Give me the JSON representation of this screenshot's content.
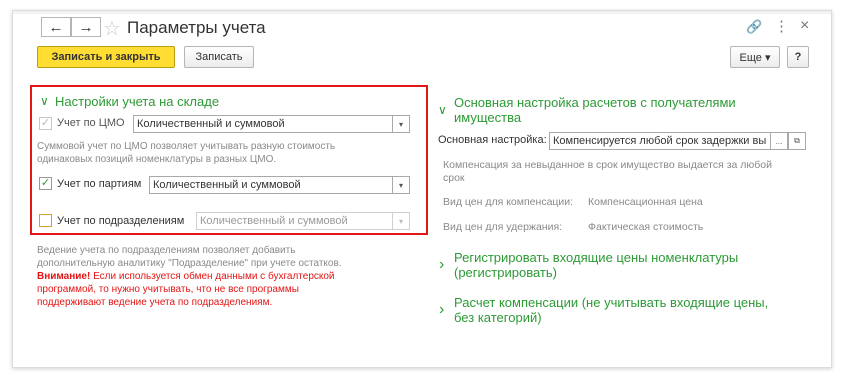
{
  "window": {
    "title": "Параметры учета",
    "back": "←",
    "forward": "→",
    "star": "☆",
    "link": "🔗",
    "menu": "⋮",
    "close": "×"
  },
  "toolbar": {
    "save_close": "Записать и закрыть",
    "save": "Записать",
    "more": "Еще ▾",
    "help": "?"
  },
  "warehouse": {
    "header": "Настройки учета на складе",
    "chevron": "∨",
    "cmo": {
      "label": "Учет по ЦМО",
      "value": "Количественный и суммовой",
      "checked": true,
      "enabled": false
    },
    "cmo_hint1": "Суммовой учет по ЦМО позволяет учитывать разную стоимость",
    "cmo_hint2": "одинаковых позиций номенклатуры в разных ЦМО.",
    "batches": {
      "label": "Учет по партиям",
      "value": "Количественный и суммовой",
      "checked": true,
      "enabled": true
    },
    "divisions": {
      "label": "Учет по подразделениям",
      "value": "Количественный и суммовой",
      "checked": false,
      "enabled": false
    },
    "checkmark": "✓",
    "dropdown": "▾"
  },
  "divisions_note": {
    "line1": "Ведение учета по подразделениям позволяет добавить",
    "line2": "дополнительную аналитику \"Подразделение\" при учете остатков.",
    "warning_bold": "Внимание!",
    "warning1": " Если используется обмен данными с бухгалтерской",
    "warning2": "программой, то нужно учитывать, что не все программы",
    "warning3": "поддерживают ведение учета по подразделениям."
  },
  "settlements": {
    "header1": "Основная настройка расчетов с получателями",
    "header2": "имущества",
    "chevron": "∨",
    "main_label": "Основная настройка:",
    "main_value": "Компенсируется любой срок задержки вы",
    "ellipsis": "...",
    "open": "⧉",
    "desc1": "Компенсация за невыданное в срок имущество выдается за любой",
    "desc2": "срок",
    "price_comp_label": "Вид цен для компенсации:",
    "price_comp_value": "Компенсационная цена",
    "price_hold_label": "Вид цен для удержания:",
    "price_hold_value": "Фактическая стоимость"
  },
  "register": {
    "chevron": "›",
    "line1": "Регистрировать входящие цены номенклатуры",
    "line2": "(регистрировать)"
  },
  "compensation": {
    "chevron": "›",
    "line1": "Расчет компенсации (не учитывать входящие цены,",
    "line2": "без категорий)"
  }
}
